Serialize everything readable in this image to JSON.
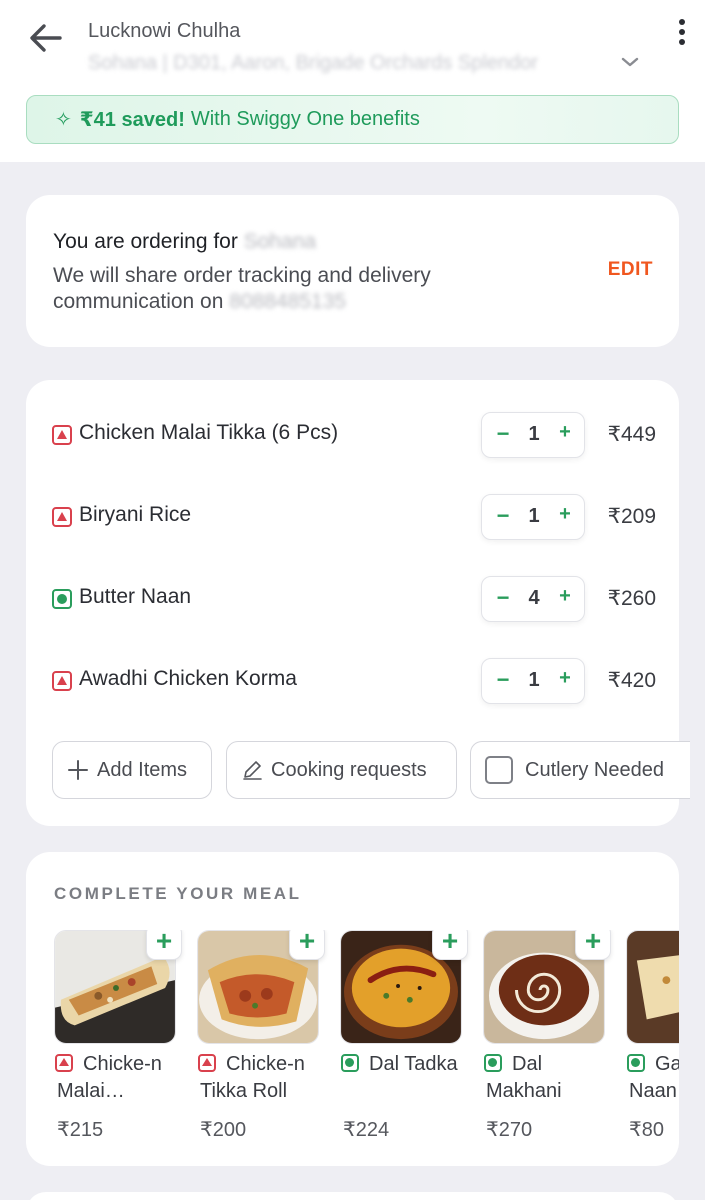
{
  "header": {
    "restaurant_name": "Lucknowi Chulha",
    "address": "Sohana | D301, Aaron, Brigade Orchards Splendor",
    "back_icon": "arrow-left-icon",
    "menu_icon": "kebab-menu-icon"
  },
  "savings": {
    "amount": "₹41 saved!",
    "text": "With Swiggy One benefits"
  },
  "contact": {
    "title": "You are ordering for",
    "name": "Sohana",
    "line": "We will share order tracking and delivery communication on",
    "phone": "8088485135",
    "edit_label": "EDIT"
  },
  "items": [
    {
      "name": "Chicken Malai Tikka (6 Pcs)",
      "type": "nonveg",
      "qty": "1",
      "price": "₹449"
    },
    {
      "name": "Biryani Rice",
      "type": "nonveg",
      "qty": "1",
      "price": "₹209"
    },
    {
      "name": "Butter Naan",
      "type": "veg",
      "qty": "4",
      "price": "₹260"
    },
    {
      "name": "Awadhi Chicken Korma",
      "type": "nonveg",
      "qty": "1",
      "price": "₹420"
    }
  ],
  "stepper": {
    "minus": "−",
    "plus": "+"
  },
  "actions": {
    "add_items": "Add Items",
    "cooking_requests": "Cooking requests",
    "cutlery": "Cutlery Needed"
  },
  "complete_meal": {
    "title": "COMPLETE YOUR MEAL",
    "add_label": "+",
    "items": [
      {
        "name": "Chicke-n Malai…",
        "type": "nonveg",
        "price": "₹215"
      },
      {
        "name": "Chicke-n Tikka Roll",
        "type": "nonveg",
        "price": "₹200"
      },
      {
        "name": "Dal Tadka",
        "type": "veg",
        "price": "₹224"
      },
      {
        "name": "Dal Makhani",
        "type": "veg",
        "price": "₹270"
      },
      {
        "name": "Garlic Naan",
        "type": "veg",
        "price": "₹80"
      }
    ]
  },
  "colors": {
    "accent_green": "#2a9d5c",
    "edit_orange": "#f0571f",
    "nonveg_red": "#d9414d",
    "background": "#eeeef3"
  }
}
